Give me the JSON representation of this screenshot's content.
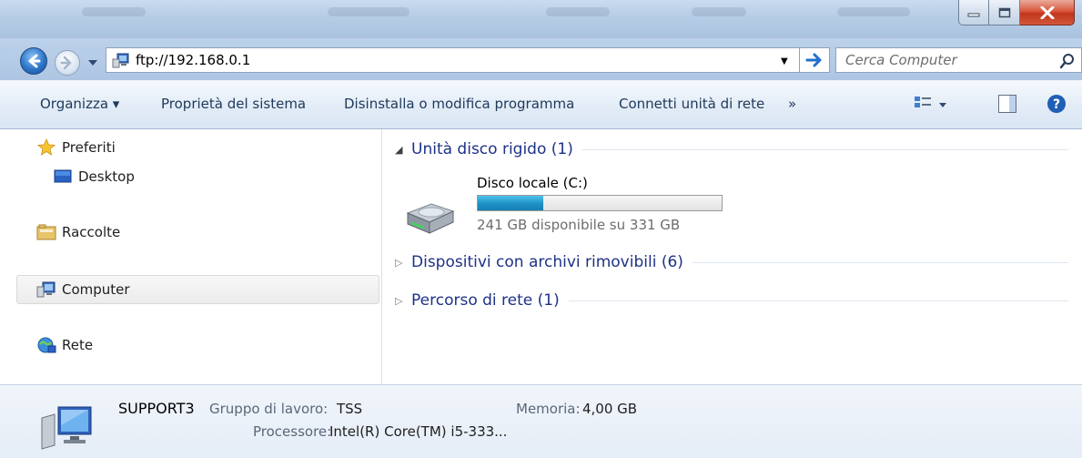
{
  "address": {
    "path": "ftp://192.168.0.1"
  },
  "search": {
    "placeholder": "Cerca Computer"
  },
  "toolbar": {
    "organize": "Organizza ▾",
    "system_properties": "Proprietà del sistema",
    "uninstall": "Disinstalla o modifica programma",
    "map_drive": "Connetti unità di rete",
    "more": "»"
  },
  "navpane": {
    "favorites": "Preferiti",
    "desktop": "Desktop",
    "libraries": "Raccolte",
    "computer": "Computer",
    "network": "Rete"
  },
  "content": {
    "groups": [
      {
        "title": "Unità disco rigido (1)",
        "expanded": true
      },
      {
        "title": "Dispositivi con archivi rimovibili (6)",
        "expanded": false
      },
      {
        "title": "Percorso di rete (1)",
        "expanded": false
      }
    ],
    "drive": {
      "name": "Disco locale (C:)",
      "info": "241 GB disponibile su 331 GB",
      "used_fraction": 0.27
    }
  },
  "details": {
    "computer_name": "SUPPORT3",
    "workgroup_label": "Gruppo di lavoro:",
    "workgroup_value": "TSS",
    "memory_label": "Memoria:",
    "memory_value": "4,00 GB",
    "processor_label": "Processore:",
    "processor_value": "Intel(R) Core(TM) i5-333..."
  },
  "colors": {
    "accent": "#1e3287",
    "drive_fill": "#2193c8",
    "toolbar_text": "#1e395b"
  }
}
